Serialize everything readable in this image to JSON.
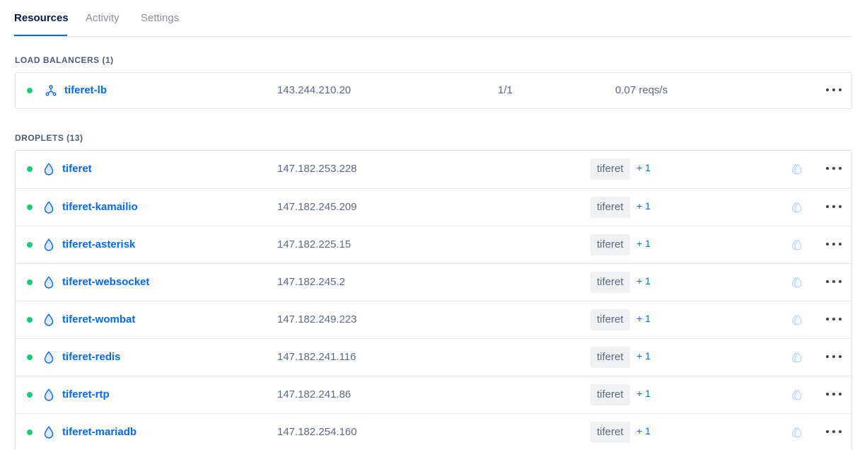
{
  "tabs": [
    {
      "label": "Resources",
      "active": true
    },
    {
      "label": "Activity",
      "active": false
    },
    {
      "label": "Settings",
      "active": false
    }
  ],
  "load_balancers": {
    "title": "LOAD BALANCERS (1)",
    "items": [
      {
        "name": "tiferet-lb",
        "ip": "143.244.210.20",
        "droplets_ratio": "1/1",
        "requests": "0.07 reqs/s",
        "status": "active",
        "icon": "load-balancer-icon"
      }
    ]
  },
  "droplets": {
    "title": "DROPLETS (13)",
    "items": [
      {
        "name": "tiferet",
        "ip": "147.182.253.228",
        "tag": "tiferet",
        "more_tags": "+ 1",
        "status": "active"
      },
      {
        "name": "tiferet-kamailio",
        "ip": "147.182.245.209",
        "tag": "tiferet",
        "more_tags": "+ 1",
        "status": "active"
      },
      {
        "name": "tiferet-asterisk",
        "ip": "147.182.225.15",
        "tag": "tiferet",
        "more_tags": "+ 1",
        "status": "active"
      },
      {
        "name": "tiferet-websocket",
        "ip": "147.182.245.2",
        "tag": "tiferet",
        "more_tags": "+ 1",
        "status": "active"
      },
      {
        "name": "tiferet-wombat",
        "ip": "147.182.249.223",
        "tag": "tiferet",
        "more_tags": "+ 1",
        "status": "active"
      },
      {
        "name": "tiferet-redis",
        "ip": "147.182.241.116",
        "tag": "tiferet",
        "more_tags": "+ 1",
        "status": "active"
      },
      {
        "name": "tiferet-rtp",
        "ip": "147.182.241.86",
        "tag": "tiferet",
        "more_tags": "+ 1",
        "status": "active"
      },
      {
        "name": "tiferet-mariadb",
        "ip": "147.182.254.160",
        "tag": "tiferet",
        "more_tags": "+ 1",
        "status": "active"
      }
    ]
  },
  "icons": {
    "droplet": "droplet-icon",
    "monitoring": "monitoring-droplet-icon",
    "menu": "more-options-icon"
  },
  "colors": {
    "accent": "#0069ff",
    "status_active": "#15cd72",
    "tag_bg": "#f0f1f3"
  }
}
